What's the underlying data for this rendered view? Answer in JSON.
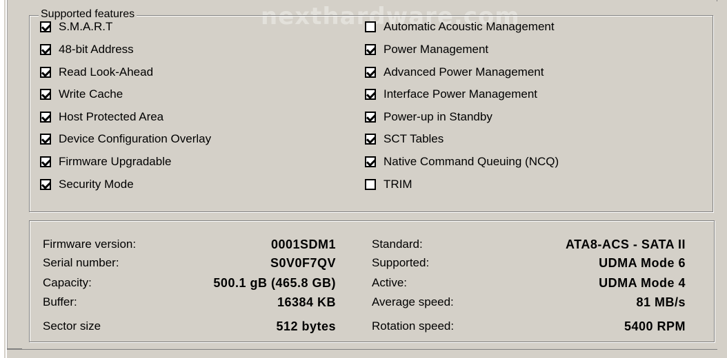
{
  "watermark": "nexthardware.com",
  "group_title": "Supported features",
  "features_left": [
    {
      "label": "S.M.A.R.T",
      "checked": true
    },
    {
      "label": "48-bit Address",
      "checked": true
    },
    {
      "label": "Read Look-Ahead",
      "checked": true
    },
    {
      "label": "Write Cache",
      "checked": true
    },
    {
      "label": "Host Protected Area",
      "checked": true
    },
    {
      "label": "Device Configuration Overlay",
      "checked": true
    },
    {
      "label": "Firmware Upgradable",
      "checked": true
    },
    {
      "label": "Security Mode",
      "checked": true
    }
  ],
  "features_right": [
    {
      "label": "Automatic Acoustic Management",
      "checked": false
    },
    {
      "label": "Power Management",
      "checked": true
    },
    {
      "label": "Advanced Power Management",
      "checked": true
    },
    {
      "label": "Interface Power Management",
      "checked": true
    },
    {
      "label": "Power-up in Standby",
      "checked": true
    },
    {
      "label": "SCT Tables",
      "checked": true
    },
    {
      "label": "Native Command Queuing (NCQ)",
      "checked": true
    },
    {
      "label": "TRIM",
      "checked": false
    }
  ],
  "info_left": [
    {
      "label": "Firmware version:",
      "value": "0001SDM1"
    },
    {
      "label": "Serial number:",
      "value": "S0V0F7QV"
    },
    {
      "label": "Capacity:",
      "value": "500.1 gB (465.8 GB)"
    },
    {
      "label": "Buffer:",
      "value": "16384 KB"
    },
    {
      "label": "Sector size",
      "value": "512 bytes"
    }
  ],
  "info_right": [
    {
      "label": "Standard:",
      "value": "ATA8-ACS - SATA II"
    },
    {
      "label": "Supported:",
      "value": "UDMA Mode 6"
    },
    {
      "label": "Active:",
      "value": "UDMA Mode 4"
    },
    {
      "label": "Average speed:",
      "value": "81 MB/s"
    },
    {
      "label": "Rotation speed:",
      "value": "5400 RPM"
    }
  ]
}
